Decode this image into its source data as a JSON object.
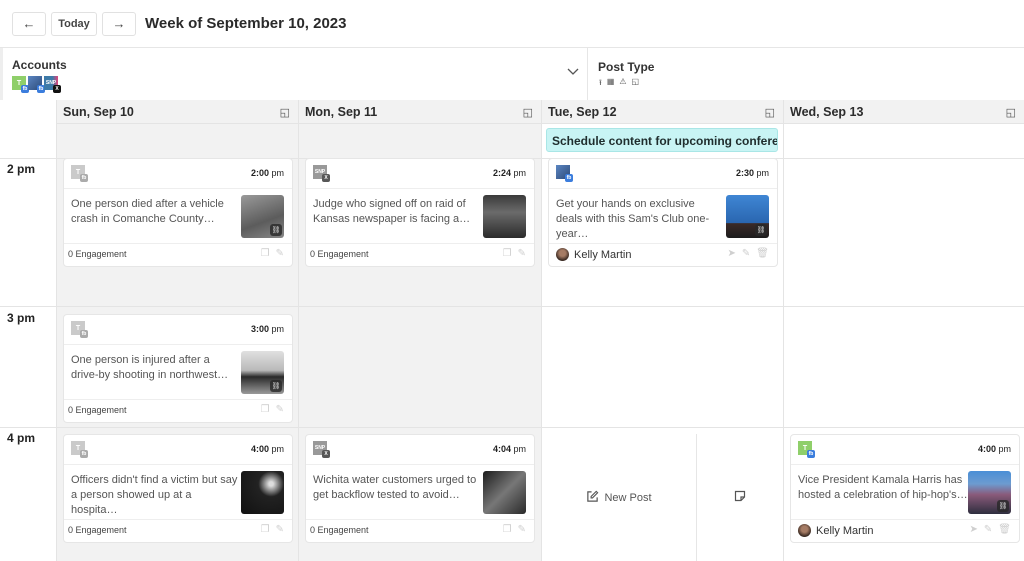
{
  "toolbar": {
    "prev_icon": "←",
    "today_label": "Today",
    "next_icon": "→",
    "week_title": "Week of September 10, 2023"
  },
  "filters": {
    "accounts_label": "Accounts",
    "accounts": [
      {
        "initials": "T",
        "color": "#8fcf6a",
        "network": "fb"
      },
      {
        "initials": "",
        "color": "#4a6fa8",
        "network": "fb"
      },
      {
        "initials": "SNP",
        "color": "#3d7aa8",
        "network": "x"
      }
    ],
    "chevron_icon": "chevron-down",
    "post_type_label": "Post Type",
    "post_type_icons": [
      "upload-icon",
      "calendar-icon",
      "warning-icon",
      "note-icon"
    ]
  },
  "calendar": {
    "days": [
      {
        "label": "Sun, Sep 10"
      },
      {
        "label": "Mon, Sep 11"
      },
      {
        "label": "Tue, Sep 12"
      },
      {
        "label": "Wed, Sep 13"
      }
    ],
    "time_slots": [
      "2 pm",
      "3 pm",
      "4 pm"
    ],
    "all_day_event": "Schedule content for upcoming conference",
    "new_post_label": "New Post",
    "posts": [
      {
        "time": "2:00",
        "ampm": "pm",
        "account": "T",
        "network": "fb",
        "text": "One person died after a vehicle crash in Comanche County…",
        "engagement": "0 Engagement"
      },
      {
        "time": "2:24",
        "ampm": "pm",
        "account": "SNP",
        "network": "x",
        "text": "Judge who signed off on raid of Kansas newspaper is facing a…",
        "engagement": "0 Engagement"
      },
      {
        "time": "2:30",
        "ampm": "pm",
        "account": "",
        "network": "fb",
        "text": "Get your hands on exclusive deals with this Sam's Club one-year…",
        "author": "Kelly Martin"
      },
      {
        "time": "3:00",
        "ampm": "pm",
        "account": "T",
        "network": "fb",
        "text": "One person is injured after a drive-by shooting in northwest…",
        "engagement": "0 Engagement"
      },
      {
        "time": "4:00",
        "ampm": "pm",
        "account": "T",
        "network": "fb",
        "text": "Officers didn't find a victim but say a person showed up at a hospita…",
        "engagement": "0 Engagement"
      },
      {
        "time": "4:04",
        "ampm": "pm",
        "account": "SNP",
        "network": "x",
        "text": "Wichita water customers urged to get backflow tested to avoid…",
        "engagement": "0 Engagement"
      },
      {
        "time": "4:00",
        "ampm": "pm",
        "account": "T",
        "network": "fb",
        "text": "Vice President Kamala Harris has hosted a celebration of hip-hop's…",
        "author": "Kelly Martin"
      }
    ]
  }
}
